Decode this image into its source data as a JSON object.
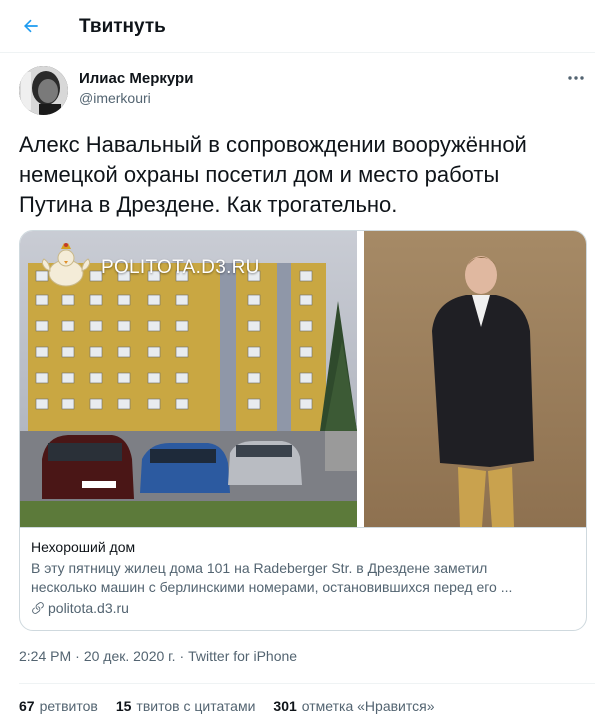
{
  "header": {
    "title": "Твитнуть",
    "back_icon": "arrow-left-icon"
  },
  "author": {
    "display_name": "Илиас Меркури",
    "handle": "@imerkouri",
    "more_icon": "more-dots-icon"
  },
  "tweet": {
    "text_lines": [
      "Алекс Навальный в сопровождении вооружённой",
      "немецкой охраны посетил дом и место работы",
      "Путина в Дрездене. Как трогательно."
    ]
  },
  "card": {
    "watermark": "POLITOTA.D3.RU",
    "title": "Нехороший дом",
    "description_lines": [
      "В эту пятницу жилец дома 101 на Radeberger Str. в Дрездене заметил",
      "несколько машин с берлинскими номерами, остановившихся перед его ..."
    ],
    "link": "politota.d3.ru",
    "link_icon": "link-icon",
    "car_plate": "B EL 1175"
  },
  "meta": {
    "time": "2:24 PM",
    "separator": "·",
    "date": "20 дек. 2020 г.",
    "source": "Twitter for iPhone"
  },
  "stats": [
    {
      "count": "67",
      "label": "ретвитов"
    },
    {
      "count": "15",
      "label": "твитов с цитатами"
    },
    {
      "count": "301",
      "label": "отметка «Нравится»"
    }
  ],
  "colors": {
    "accent": "#1d9bf0",
    "text": "#0f1419",
    "secondary": "#536471",
    "border": "#cfd9de"
  }
}
